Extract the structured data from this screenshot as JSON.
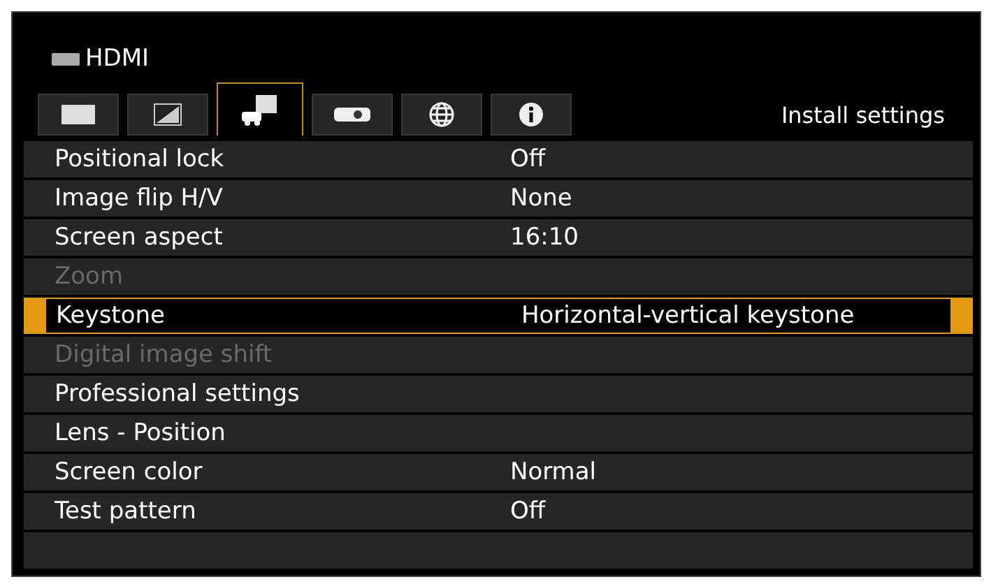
{
  "source": {
    "title": "HDMI"
  },
  "tabs": [
    {
      "kind": "image",
      "selected": false
    },
    {
      "kind": "adjust",
      "selected": false
    },
    {
      "kind": "install",
      "selected": true
    },
    {
      "kind": "projector",
      "selected": false
    },
    {
      "kind": "network",
      "selected": false
    },
    {
      "kind": "info",
      "selected": false
    }
  ],
  "tab_title": "Install settings",
  "rows": [
    {
      "label": "Positional lock",
      "value": "Off",
      "disabled": false,
      "selected": false
    },
    {
      "label": "Image flip H/V",
      "value": "None",
      "disabled": false,
      "selected": false
    },
    {
      "label": "Screen aspect",
      "value": "16:10",
      "disabled": false,
      "selected": false
    },
    {
      "label": "Zoom",
      "disabled": true,
      "selected": false
    },
    {
      "label": "Keystone",
      "value": "Horizontal-vertical keystone",
      "disabled": false,
      "selected": true
    },
    {
      "label": "Digital image shift",
      "disabled": true,
      "selected": false
    },
    {
      "label": "Professional settings",
      "disabled": false,
      "selected": false
    },
    {
      "label": "Lens - Position",
      "disabled": false,
      "selected": false
    },
    {
      "label": "Screen color",
      "value": "Normal",
      "disabled": false,
      "selected": false
    },
    {
      "label": "Test pattern",
      "value": "Off",
      "disabled": false,
      "selected": false
    }
  ]
}
